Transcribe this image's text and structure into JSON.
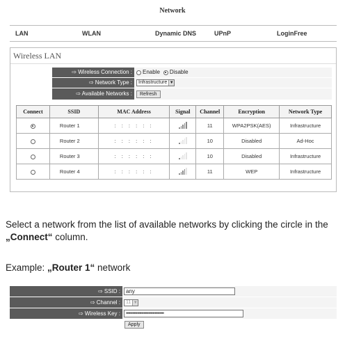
{
  "page_title": "Network",
  "tabs": [
    {
      "label": "LAN"
    },
    {
      "label": "WLAN"
    },
    {
      "label": "Dynamic DNS"
    },
    {
      "label": "UPnP"
    },
    {
      "label": "LoginFree"
    }
  ],
  "wireless_panel": {
    "title": "Wireless LAN",
    "wireless_connection": {
      "label": "⇨ Wireless Connection :",
      "enable": "Enable",
      "disable": "Disable",
      "selected": "Disable"
    },
    "network_type": {
      "label": "⇨ Network Type :",
      "value": "Infrastructure"
    },
    "available_networks": {
      "label": "⇨ Available Networks :",
      "button": "Refresh"
    }
  },
  "networks_table": {
    "headers": [
      "Connect",
      "SSID",
      "MAC Address",
      "Signal",
      "Channel",
      "Encryption",
      "Network Type"
    ],
    "rows": [
      {
        "selected": true,
        "ssid": "Router 1",
        "mac": ": : : : : :",
        "signal": 5,
        "channel": "11",
        "encryption": "WPA2PSK(AES)",
        "type": "Infrastructure"
      },
      {
        "selected": false,
        "ssid": "Router 2",
        "mac": ": : : : : :",
        "signal": 1,
        "channel": "10",
        "encryption": "Disabled",
        "type": "Ad-Hoc"
      },
      {
        "selected": false,
        "ssid": "Router 3",
        "mac": ": : : : : :",
        "signal": 1,
        "channel": "10",
        "encryption": "Disabled",
        "type": "Infrastructure"
      },
      {
        "selected": false,
        "ssid": "Router 4",
        "mac": ": : : : : :",
        "signal": 4,
        "channel": "11",
        "encryption": "WEP",
        "type": "Infrastructure"
      }
    ]
  },
  "instructions": {
    "line1_pre": "Select a network from the list of available networks by clicking the circle in the ",
    "line1_bold": "„Connect“",
    "line1_post": " column.",
    "example_pre": "Example: ",
    "example_bold": "„Router 1“",
    "example_post": " network"
  },
  "ssid_form": {
    "ssid_label": "⇨ SSID :",
    "ssid_value": "any",
    "channel_label": "⇨ Channel :",
    "channel_value": "11",
    "key_label": "⇨ Wireless Key :",
    "key_value": "••••••••••••••••••••••••••••••••••",
    "apply": "Apply"
  },
  "colors": {
    "label_bg": "#5a5a5a",
    "value_bg": "#f4f4f4"
  }
}
